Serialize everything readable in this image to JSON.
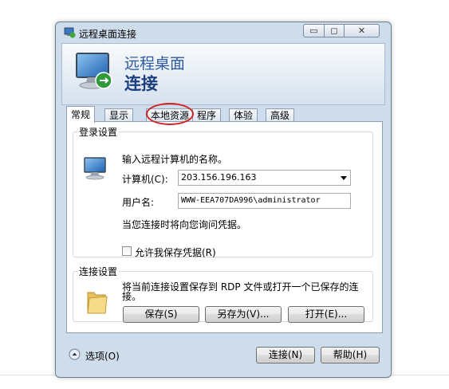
{
  "window": {
    "title": "远程桌面连接",
    "buttons": {
      "minimize": "▭",
      "maximize": "◻",
      "close": "✕"
    }
  },
  "banner": {
    "line1": "远程桌面",
    "line2": "连接"
  },
  "tabs": [
    {
      "label": "常规",
      "active": true
    },
    {
      "label": "显示",
      "active": false
    },
    {
      "label": "本地资源",
      "active": false
    },
    {
      "label": "程序",
      "active": false
    },
    {
      "label": "体验",
      "active": false
    },
    {
      "label": "高级",
      "active": false
    }
  ],
  "login": {
    "legend": "登录设置",
    "instruction": "输入远程计算机的名称。",
    "computer_label": "计算机(C):",
    "computer_value": "203.156.196.163",
    "username_label": "用户名:",
    "username_value": "WWW-EEA707DA996\\administrator",
    "credential_note": "当您连接时将向您询问凭据。",
    "save_credentials_label": "允许我保存凭据(R)",
    "save_credentials_checked": false
  },
  "connection": {
    "legend": "连接设置",
    "description": "将当前连接设置保存到 RDP 文件或打开一个已保存的连接。",
    "save_button": "保存(S)",
    "save_as_button": "另存为(V)...",
    "open_button": "打开(E)..."
  },
  "footer": {
    "options_label": "选项(O)",
    "connect_button": "连接(N)",
    "help_button": "帮助(H)"
  },
  "colors": {
    "annotation_circle": "#d02020",
    "banner_text": "#2d5aa0"
  }
}
